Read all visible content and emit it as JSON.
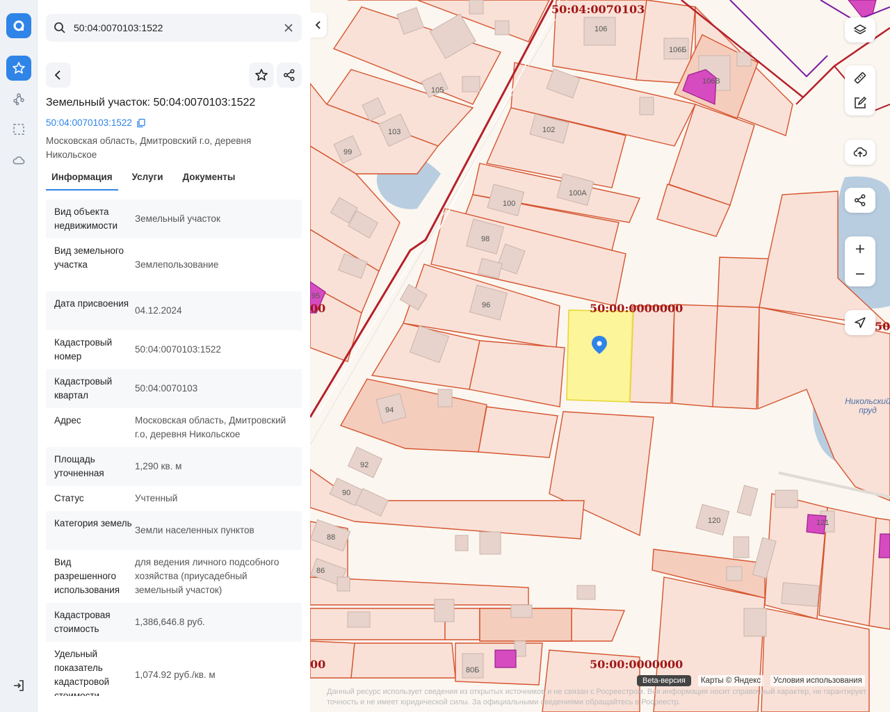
{
  "search": {
    "value": "50:04:0070103:1522"
  },
  "panel": {
    "title": "Земельный участок: 50:04:0070103:1522",
    "cad_link": "50:04:0070103:1522",
    "address": "Московская область, Дмитровский г.о, деревня Никольское",
    "tabs": [
      {
        "label": "Информация"
      },
      {
        "label": "Услуги"
      },
      {
        "label": "Документы"
      }
    ],
    "rows": [
      {
        "key": "Вид объекта недвижимости",
        "value": "Земельный участок"
      },
      {
        "key": "Вид земельного участка",
        "value": "Землепользование"
      },
      {
        "key": "Дата присвоения",
        "value": "04.12.2024"
      },
      {
        "key": "Кадастровый номер",
        "value": "50:04:0070103:1522"
      },
      {
        "key": "Кадастровый квартал",
        "value": "50:04:0070103"
      },
      {
        "key": "Адрес",
        "value": "Московская область, Дмитровский г.о, деревня Никольское"
      },
      {
        "key": "Площадь уточненная",
        "value": "1,290 кв. м"
      },
      {
        "key": "Статус",
        "value": "Учтенный"
      },
      {
        "key": "Категория земель",
        "value": "Земли населенных пунктов"
      },
      {
        "key": "Вид разрешенного использования",
        "value": "для ведения личного подсобного хозяйства (приусадебный земельный участок)"
      },
      {
        "key": "Кадастровая стоимость",
        "value": "1,386,646.8 руб."
      },
      {
        "key": "Удельный показатель кадастровой стоимости",
        "value": "1,074.92 руб./кв. м"
      }
    ]
  },
  "map": {
    "labels": {
      "quarter_top": "50:04:0070103",
      "zero_mid": "50:00:0000000",
      "zero_bottom": "50:00:0000000",
      "left_mid": "00",
      "left_bottom": "00",
      "right_mid": "50:"
    },
    "pond": "Никольский пруд",
    "parcels": [
      "106",
      "106Б",
      "106В",
      "105",
      "103",
      "99",
      "102",
      "100",
      "100А",
      "98",
      "96",
      "95",
      "94",
      "92",
      "90",
      "88",
      "86",
      "120",
      "121",
      "80Б"
    ],
    "attribution": {
      "beta": "Beta-версия",
      "maps": "Карты © Яндекс",
      "terms": "Условия использования"
    },
    "disclaimer": "Данный ресурс использует сведения из открытых источников и не связан с Росреестром. Вся информация носит справочный характер, не гарантирует точность и не имеет юридической силы. За официальными сведениями обращайтесь в Росреестр.",
    "colors": {
      "parcel_fill": "#f9e1d8",
      "parcel_stroke": "#d5542e",
      "selected": "#fdf48a",
      "road_red": "#b5202a",
      "pink": "#d64bc0",
      "water": "#b8cde0"
    }
  }
}
